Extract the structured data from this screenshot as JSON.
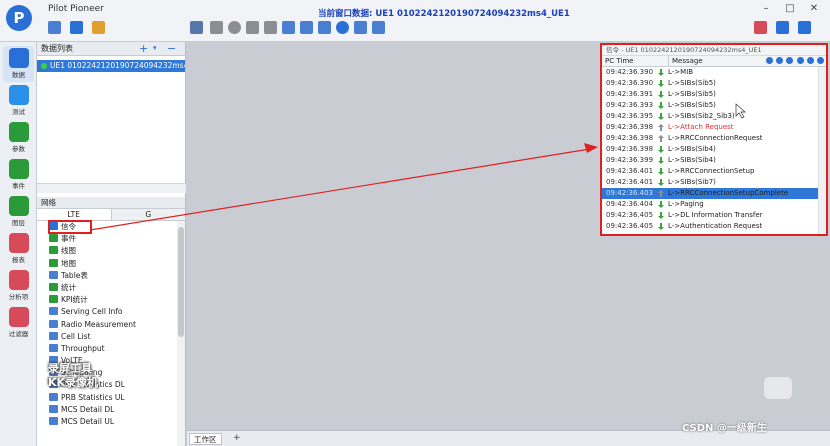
{
  "app": {
    "title": "Pilot Pioneer",
    "window_title": "当前窗口数据: UE1 0102242120190724094232ms4_UE1",
    "logo_letter": "P"
  },
  "window_controls": [
    "–",
    "□",
    "✕"
  ],
  "leftnav": {
    "items": [
      {
        "label": "数据",
        "icon": "data-icon",
        "color": "#2a6fd6"
      },
      {
        "label": "测试",
        "icon": "test-icon",
        "color": "#2a8fe6"
      },
      {
        "label": "参数",
        "icon": "param-icon",
        "color": "#2b9b3a"
      },
      {
        "label": "事件",
        "icon": "event-icon",
        "color": "#2b9b3a"
      },
      {
        "label": "图层",
        "icon": "map-layer-icon",
        "color": "#2b9b3a"
      },
      {
        "label": "报表",
        "icon": "report-icon",
        "color": "#d64a5a"
      },
      {
        "label": "分析项",
        "icon": "analysis-icon",
        "color": "#d64a5a"
      },
      {
        "label": "过滤器",
        "icon": "filter-icon",
        "color": "#d64a5a"
      }
    ]
  },
  "datalist": {
    "title": "数据列表",
    "items": [
      {
        "label": "UE1 0102242120190724094232ms4"
      }
    ]
  },
  "network": {
    "title": "网络",
    "tabs": [
      "LTE",
      "G"
    ],
    "items": [
      "信令",
      "事件",
      "线图",
      "地图",
      "Table表",
      "统计",
      "KPI统计",
      "Serving Cell Info",
      "Radio Measurement",
      "Cell List",
      "Throughput",
      "VoLTE",
      "Scheduling",
      "PRB Statistics DL",
      "PRB Statistics UL",
      "MCS Detail DL",
      "MCS Detail UL"
    ]
  },
  "workspace": {
    "bottom_tab": "工作区",
    "bottom_add": "+"
  },
  "signaling": {
    "title": "信令 - UE1 0102242120190724094232ms4_UE1",
    "columns": {
      "time": "PC Time",
      "message": "Message"
    },
    "rows": [
      {
        "time": "09:42:36.390",
        "msg": "L->MIB",
        "dir": "down",
        "color": "#222"
      },
      {
        "time": "09:42:36.390",
        "msg": "L->SIBs(Sib5)",
        "dir": "down",
        "color": "#222"
      },
      {
        "time": "09:42:36.391",
        "msg": "L->SIBs(Sib5)",
        "dir": "down",
        "color": "#222"
      },
      {
        "time": "09:42:36.393",
        "msg": "L->SIBs(Sib5)",
        "dir": "down",
        "color": "#222"
      },
      {
        "time": "09:42:36.395",
        "msg": "L->SIBs(Sib2_Sib3)",
        "dir": "down",
        "color": "#222"
      },
      {
        "time": "09:42:36.398",
        "msg": "L->Attach Request",
        "dir": "up",
        "color": "#e03030"
      },
      {
        "time": "09:42:36.398",
        "msg": "L->RRCConnectionRequest",
        "dir": "up",
        "color": "#222"
      },
      {
        "time": "09:42:36.398",
        "msg": "L->SIBs(Sib4)",
        "dir": "down",
        "color": "#222"
      },
      {
        "time": "09:42:36.399",
        "msg": "L->SIBs(Sib4)",
        "dir": "down",
        "color": "#222"
      },
      {
        "time": "09:42:36.401",
        "msg": "L->RRCConnectionSetup",
        "dir": "down",
        "color": "#222"
      },
      {
        "time": "09:42:36.401",
        "msg": "L->SIBs(Sib7)",
        "dir": "down",
        "color": "#222"
      },
      {
        "time": "09:42:36.403",
        "msg": "L->RRCConnectionSetupComplete",
        "dir": "up",
        "color": "#222"
      },
      {
        "time": "09:42:36.404",
        "msg": "L->Paging",
        "dir": "down",
        "color": "#222"
      },
      {
        "time": "09:42:36.405",
        "msg": "L->DL Information Transfer",
        "dir": "down",
        "color": "#222"
      },
      {
        "time": "09:42:36.405",
        "msg": "L->Authentication Request",
        "dir": "down",
        "color": "#222"
      }
    ],
    "selected_index": 11
  },
  "overlay_text": {
    "caption_lines": [
      "录屏工具",
      "KK录像机"
    ],
    "watermark": "CSDN @一级新生"
  },
  "colors": {
    "accent": "#2a6fd6",
    "selection": "#2f78d8",
    "highlight_red": "#e02020",
    "arrow_down": "#3aa53a",
    "arrow_up": "#8a8f96"
  }
}
